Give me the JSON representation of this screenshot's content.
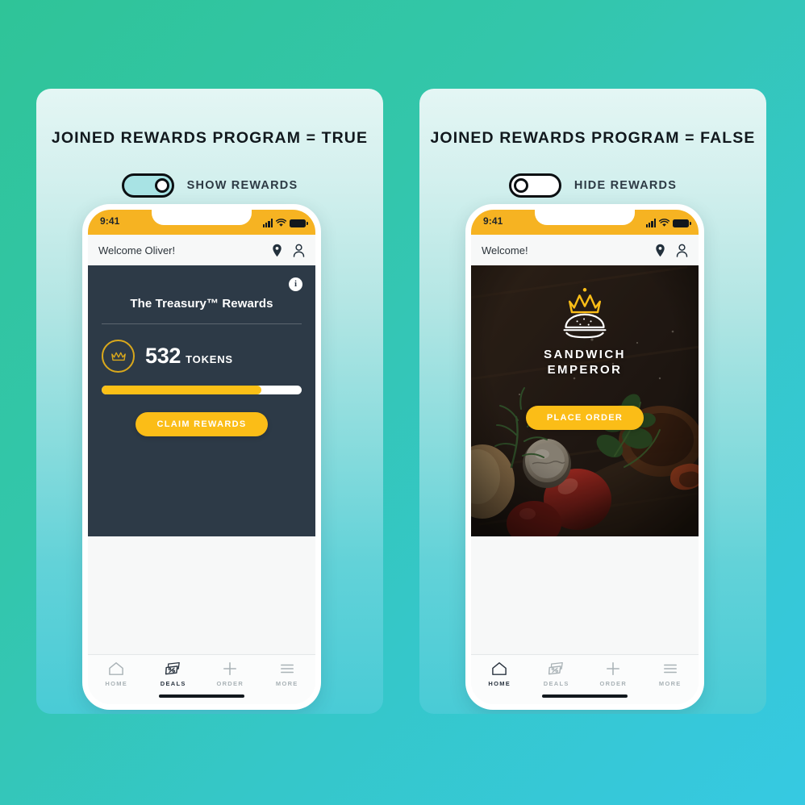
{
  "background": {
    "gradient_from": "#2fc498",
    "gradient_to": "#36c9e2"
  },
  "theme": {
    "accent_yellow": "#f6b322",
    "button_yellow": "#fbbd17",
    "panel_dark": "#2d3a47",
    "card_gradient_from": "#e4f6f4",
    "card_gradient_to": "#49cbd6",
    "text_dark": "#11181d",
    "tab_inactive": "#a9b2b6",
    "tab_active": "#2a3440"
  },
  "cards": [
    {
      "title": "JOINED REWARDS PROGRAM = TRUE",
      "toggle": {
        "state": "on",
        "label": "SHOW REWARDS"
      },
      "phone": {
        "status": {
          "time": "9:41",
          "signal_icon": "signal-bars-icon",
          "wifi_icon": "wifi-icon",
          "battery_icon": "battery-icon"
        },
        "header": {
          "welcome": "Welcome Oliver!",
          "location_icon": "location-pin-icon",
          "account_icon": "person-icon"
        },
        "rewards": {
          "info_icon": "info-icon",
          "info_glyph": "i",
          "title": "The Treasury™ Rewards",
          "crown_icon": "crown-icon",
          "token_count": "532",
          "token_unit": "TOKENS",
          "progress_percent": 80,
          "cta_label": "CLAIM REWARDS"
        },
        "tabs": [
          {
            "label": "HOME",
            "icon": "home-icon",
            "active": false
          },
          {
            "label": "DEALS",
            "icon": "deals-tag-icon",
            "active": true
          },
          {
            "label": "ORDER",
            "icon": "plus-icon",
            "active": false
          },
          {
            "label": "MORE",
            "icon": "menu-icon",
            "active": false
          }
        ]
      }
    },
    {
      "title": "JOINED REWARDS PROGRAM = FALSE",
      "toggle": {
        "state": "off",
        "label": "HIDE REWARDS"
      },
      "phone": {
        "status": {
          "time": "9:41",
          "signal_icon": "signal-bars-icon",
          "wifi_icon": "wifi-icon",
          "battery_icon": "battery-icon"
        },
        "header": {
          "welcome": "Welcome!",
          "location_icon": "location-pin-icon",
          "account_icon": "person-icon"
        },
        "hero": {
          "crown_icon": "crown-icon",
          "burger_icon": "burger-icon",
          "brand_line1": "SANDWICH",
          "brand_line2": "EMPEROR",
          "cta_label": "PLACE ORDER",
          "photo_description": "dark food photograph with tomatoes herbs and jar on wooden board"
        },
        "tabs": [
          {
            "label": "HOME",
            "icon": "home-icon",
            "active": true
          },
          {
            "label": "DEALS",
            "icon": "deals-tag-icon",
            "active": false
          },
          {
            "label": "ORDER",
            "icon": "plus-icon",
            "active": false
          },
          {
            "label": "MORE",
            "icon": "menu-icon",
            "active": false
          }
        ]
      }
    }
  ]
}
